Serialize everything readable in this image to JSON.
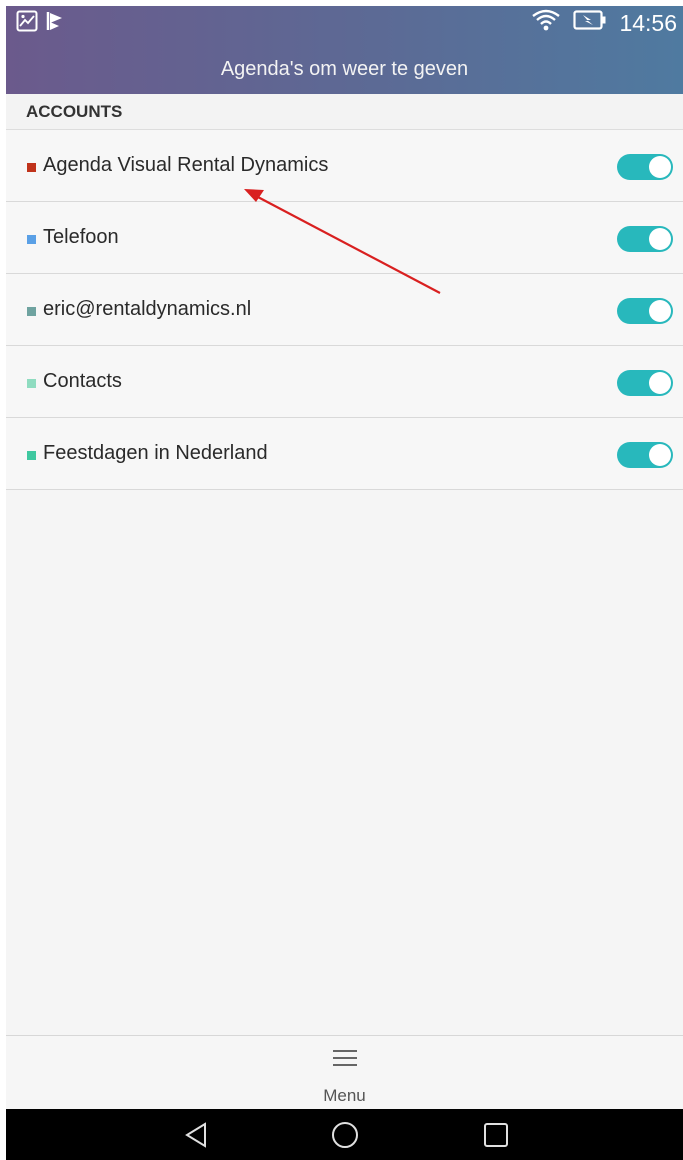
{
  "status_bar": {
    "time": "14:56",
    "icons": [
      "gallery-icon",
      "download-flag-icon",
      "wifi-icon",
      "battery-charging-icon"
    ]
  },
  "app_bar": {
    "title": "Agenda's om weer te geven"
  },
  "section": {
    "title": "ACCOUNTS"
  },
  "calendars": [
    {
      "label": "Agenda Visual Rental Dynamics",
      "color": "#c0331b",
      "enabled": true
    },
    {
      "label": "Telefoon",
      "color": "#5aa0e6",
      "enabled": true
    },
    {
      "label": "eric@rentaldynamics.nl",
      "color": "#6fa3a0",
      "enabled": true
    },
    {
      "label": "Contacts",
      "color": "#8fdcc0",
      "enabled": true
    },
    {
      "label": "Feestdagen in Nederland",
      "color": "#3fc8a0",
      "enabled": true
    }
  ],
  "bottom_bar": {
    "menu_label": "Menu"
  },
  "colors": {
    "toggle_on": "#28b8bc",
    "annotation_arrow": "#d92020"
  }
}
